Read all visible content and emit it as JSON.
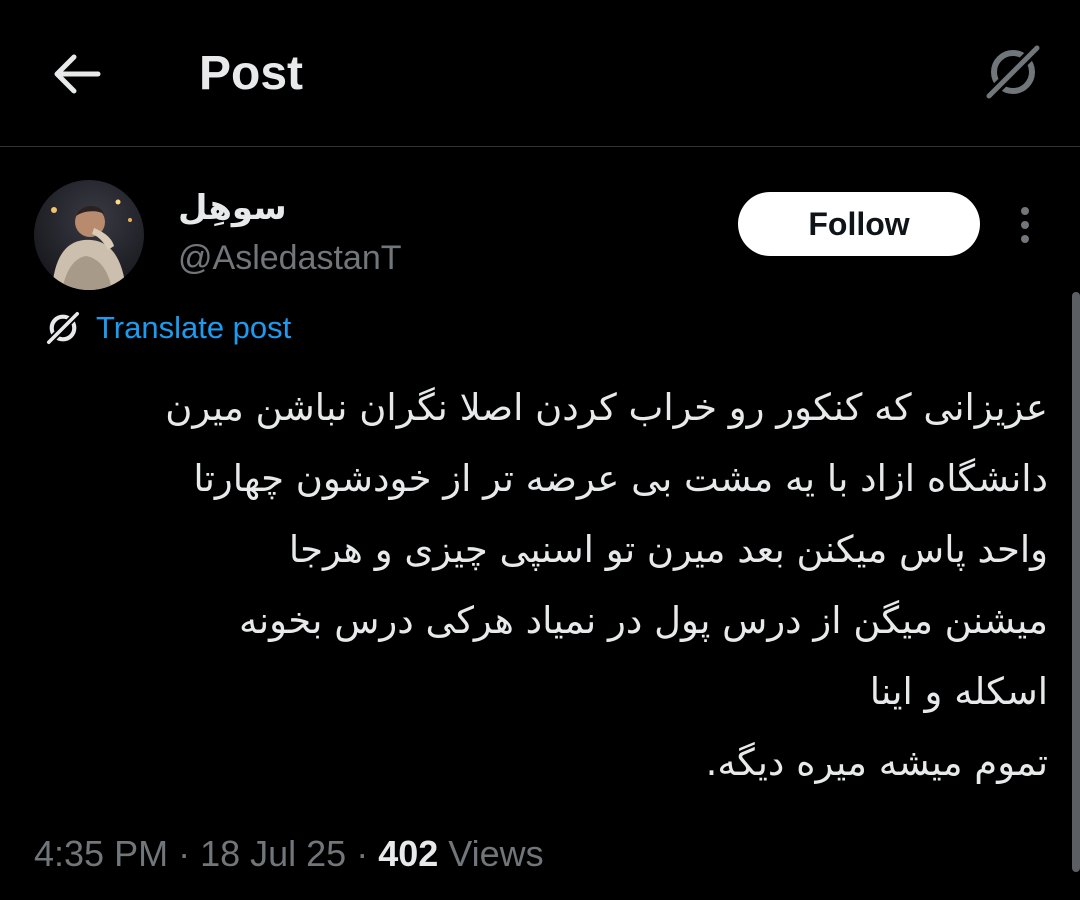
{
  "header": {
    "back_icon": "arrow-left-icon",
    "title": "Post",
    "grok_icon": "grok-icon"
  },
  "author": {
    "display_name": "سوهِل",
    "handle": "@AsledastanT",
    "avatar_icon": "avatar-photo"
  },
  "actions": {
    "follow_label": "Follow",
    "more_icon": "more-vertical-icon"
  },
  "translate": {
    "icon": "grok-icon",
    "label": "Translate post"
  },
  "post": {
    "lines": [
      "عزیزانی که کنکور رو خراب کردن اصلا نگران نباشن میرن",
      "دانشگاه ازاد با یه مشت بی عرضه تر از خودشون چهارتا",
      "واحد پاس میکنن بعد میرن تو اسنپی چیزی و هرجا",
      "میشنن میگن از درس پول در نمیاد هرکی درس بخونه",
      "اسکله و اینا",
      "تموم میشه میره دیگه."
    ]
  },
  "meta": {
    "time": "4:35 PM",
    "sep1": " · ",
    "date": "18 Jul 25",
    "sep2": " · ",
    "views_count": "402",
    "views_label": " Views"
  },
  "colors": {
    "background": "#000000",
    "text": "#e7e9ea",
    "secondary": "#71767b",
    "link": "#1d9bf0",
    "divider": "#2f3336"
  }
}
